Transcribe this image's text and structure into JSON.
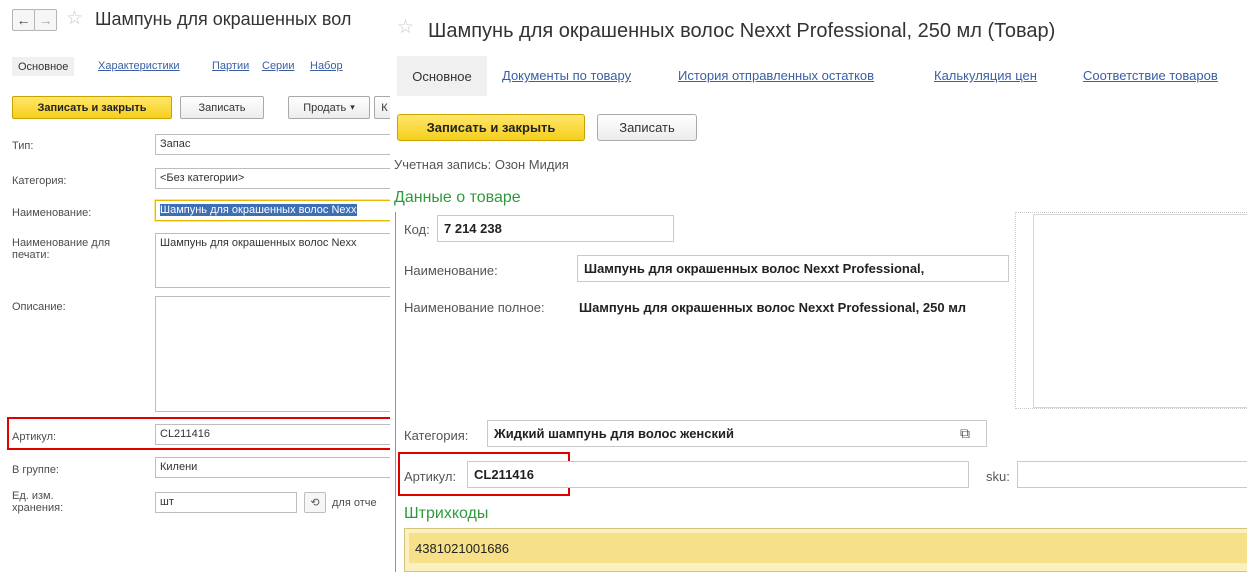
{
  "left": {
    "title": "Шампунь для окрашенных вол",
    "tabs": [
      "Основное",
      "Характеристики",
      "Партии",
      "Серии",
      "Набор"
    ],
    "buttons": {
      "save_close": "Записать и закрыть",
      "save": "Записать",
      "sell": "Продать",
      "sell_arrow": "▾",
      "more": "К"
    },
    "fields": {
      "type_label": "Тип:",
      "type_value": "Запас",
      "category_label": "Категория:",
      "category_value": "<Без категории>",
      "name_label": "Наименование:",
      "name_value": "Шампунь для окрашенных волос Nexx",
      "print_name_label": "Наименование для печати:",
      "print_name_value": "Шампунь для окрашенных волос Nexx",
      "description_label": "Описание:",
      "description_value": "",
      "article_label": "Артикул:",
      "article_value": "CL211416",
      "group_label": "В группе:",
      "group_value": "Килени",
      "unit_label": "Ед. изм. хранения:",
      "unit_value": "шт",
      "unit_suffix": "для отче"
    },
    "icons": {
      "back": "←",
      "forward": "→",
      "star": "☆",
      "unit_history": "⟲"
    }
  },
  "right": {
    "title": "Шампунь для окрашенных волос Nexxt Professional, 250 мл (Товар)",
    "tabs": [
      "Основное",
      "Документы по товару",
      "История отправленных остатков",
      "Калькуляция цен",
      "Соответствие товаров"
    ],
    "buttons": {
      "save_close": "Записать и закрыть",
      "save": "Записать"
    },
    "account": "Учетная запись: Озон Мидия",
    "group_product": "Данные о товаре",
    "code_label": "Код:",
    "code_value": "7 214 238",
    "name_label": "Наименование:",
    "name_value": "Шампунь для окрашенных волос Nexxt Professional,",
    "full_name_label": "Наименование полное:",
    "full_name_value": "Шампунь для окрашенных волос Nexxt Professional, 250 мл",
    "category_label": "Категория:",
    "category_value": "Жидкий шампунь для волос женский",
    "article_label": "Артикул:",
    "article_value": "CL211416",
    "sku_label": "sku:",
    "barcodes_label": "Штрихкоды",
    "barcode_value": "4381021001686",
    "icons": {
      "star": "☆",
      "open": "⧉"
    }
  }
}
